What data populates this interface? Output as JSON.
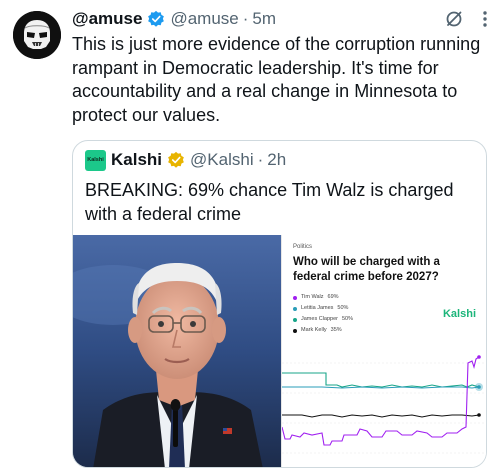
{
  "tweet": {
    "display_name": "@amuse",
    "handle": "@amuse",
    "time": "5m",
    "text": "This is just more evidence of the corruption running rampant in Democratic leadership. It's time for accountability and a real change in Minnesota to protect our values."
  },
  "quote": {
    "logo_text": "Kalshi",
    "display_name": "Kalshi",
    "handle": "@Kalshi",
    "time": "2h",
    "text": "BREAKING: 69% chance Tim Walz is charged with a federal crime"
  },
  "card": {
    "category": "Politics",
    "title": "Who will be charged with a federal crime before 2027?",
    "legend": [
      {
        "name": "Tim Walz",
        "value": "69%",
        "color": "#a020f0"
      },
      {
        "name": "Letitia James",
        "value": "50%",
        "color": "#2a9db8"
      },
      {
        "name": "James Clapper",
        "value": "50%",
        "color": "#17a589"
      },
      {
        "name": "Mark Kelly",
        "value": "35%",
        "color": "#111111"
      }
    ],
    "brand": "Kalshi"
  },
  "colors": {
    "text": "#0f1419",
    "muted": "#536471",
    "verified_blue": "#1d9bf0",
    "verified_gold": "#e8b400",
    "kalshi_green": "#1cc88a"
  },
  "icons": [
    "avatar-stormtrooper",
    "verified-badge-icon",
    "grok-icon",
    "more-icon",
    "gold-verified-badge-icon"
  ]
}
